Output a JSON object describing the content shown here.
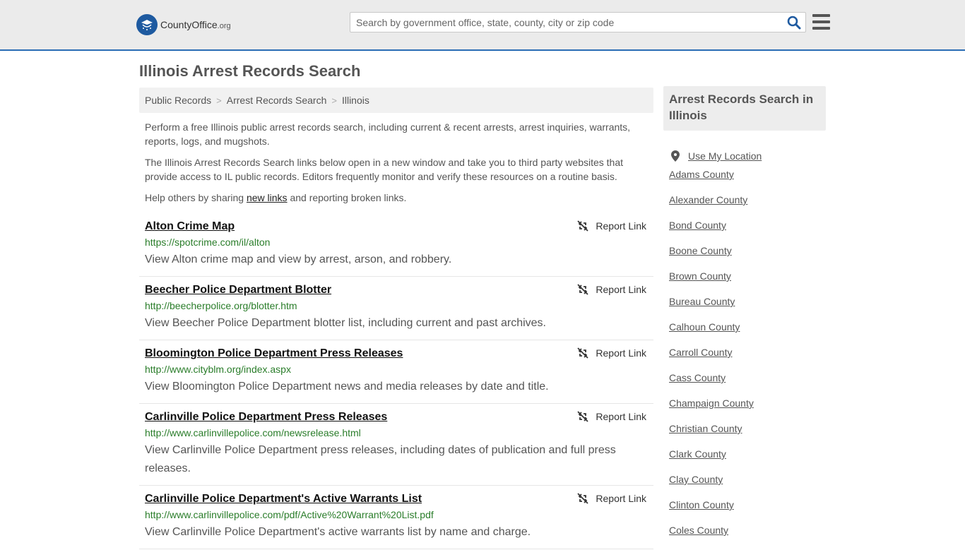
{
  "header": {
    "logo_text_main": "CountyOffice",
    "logo_text_suffix": ".org",
    "search_placeholder": "Search by government office, state, county, city or zip code"
  },
  "page": {
    "title": "Illinois Arrest Records Search"
  },
  "breadcrumb": [
    "Public Records",
    "Arrest Records Search",
    "Illinois"
  ],
  "intro": {
    "p1": "Perform a free Illinois public arrest records search, including current & recent arrests, arrest inquiries, warrants, reports, logs, and mugshots.",
    "p2": "The Illinois Arrest Records Search links below open in a new window and take you to third party websites that provide access to IL public records. Editors frequently monitor and verify these resources on a routine basis.",
    "p3_before": "Help others by sharing ",
    "p3_link": "new links",
    "p3_after": " and reporting broken links."
  },
  "report_label": "Report Link",
  "results": [
    {
      "title": "Alton Crime Map",
      "url": "https://spotcrime.com/il/alton",
      "desc": "View Alton crime map and view by arrest, arson, and robbery."
    },
    {
      "title": "Beecher Police Department Blotter",
      "url": "http://beecherpolice.org/blotter.htm",
      "desc": "View Beecher Police Department blotter list, including current and past archives."
    },
    {
      "title": "Bloomington Police Department Press Releases",
      "url": "http://www.cityblm.org/index.aspx",
      "desc": "View Bloomington Police Department news and media releases by date and title."
    },
    {
      "title": "Carlinville Police Department Press Releases",
      "url": "http://www.carlinvillepolice.com/newsrelease.html",
      "desc": "View Carlinville Police Department press releases, including dates of publication and full press releases."
    },
    {
      "title": "Carlinville Police Department's Active Warrants List",
      "url": "http://www.carlinvillepolice.com/pdf/Active%20Warrant%20List.pdf",
      "desc": "View Carlinville Police Department's active warrants list by name and charge."
    }
  ],
  "sidebar": {
    "heading": "Arrest Records Search in Illinois",
    "location_label": "Use My Location",
    "counties": [
      "Adams County",
      "Alexander County",
      "Bond County",
      "Boone County",
      "Brown County",
      "Bureau County",
      "Calhoun County",
      "Carroll County",
      "Cass County",
      "Champaign County",
      "Christian County",
      "Clark County",
      "Clay County",
      "Clinton County",
      "Coles County"
    ]
  },
  "colors": {
    "accent": "#2a6db5",
    "url_green": "#2a7d2a"
  }
}
